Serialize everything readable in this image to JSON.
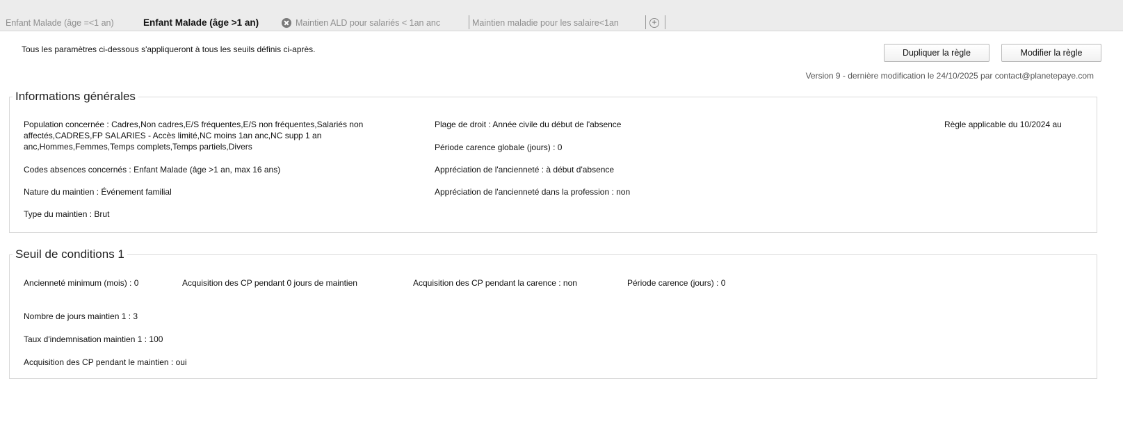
{
  "tabs": [
    {
      "label": "Enfant  Malade (âge =<1 an)",
      "active": false
    },
    {
      "label": "Enfant  Malade (âge >1 an)",
      "active": true
    },
    {
      "label": "Maintien ALD pour salariés < 1an anc",
      "active": false
    },
    {
      "label": "Maintien maladie pour les salaire<1an",
      "active": false
    }
  ],
  "intro_text": "Tous les paramètres ci-dessous s'appliqueront à tous les seuils définis ci-après.",
  "buttons": {
    "duplicate": "Dupliquer la règle",
    "modify": "Modifier la règle"
  },
  "version_line": "Version 9  - dernière modification le 24/10/2025  par contact@planetepaye.com",
  "general": {
    "title": "Informations générales",
    "population": "Population concernée : Cadres,Non cadres,E/S fréquentes,E/S non fréquentes,Salariés non affectés,CADRES,FP SALARIES - Accès limité,NC moins 1an anc,NC supp 1 an anc,Hommes,Femmes,Temps complets,Temps partiels,Divers",
    "codes": "Codes absences concernés : Enfant  Malade (âge >1 an, max 16 ans)",
    "nature": "Nature du maintien : Événement familial",
    "type": "Type du maintien : Brut",
    "plage": "Plage de droit : Année civile du début de l'absence",
    "carence_globale": "Période carence globale (jours) : 0",
    "anciennete": "Appréciation de l'ancienneté : à début d'absence",
    "anciennete_profession": "Appréciation de l'ancienneté dans la profession : non",
    "applicable": "Règle applicable du 10/2024  au"
  },
  "threshold": {
    "title": "Seuil de conditions 1",
    "anciennete_min": "Ancienneté minimum (mois) : 0",
    "acq_cp_jours": "Acquisition des CP pendant 0  jours de maintien",
    "acq_cp_carence": "Acquisition des CP pendant la carence : non",
    "periode_carence": "Période carence (jours) : 0",
    "nb_jours": "Nombre de jours maintien 1 : 3",
    "taux": "Taux d'indemnisation maintien 1 : 100",
    "acq_cp_maintien": "Acquisition des CP pendant le maintien : oui"
  },
  "icons": {
    "close_tab": "close-circle-icon",
    "add_tab": "add-circle-icon"
  }
}
